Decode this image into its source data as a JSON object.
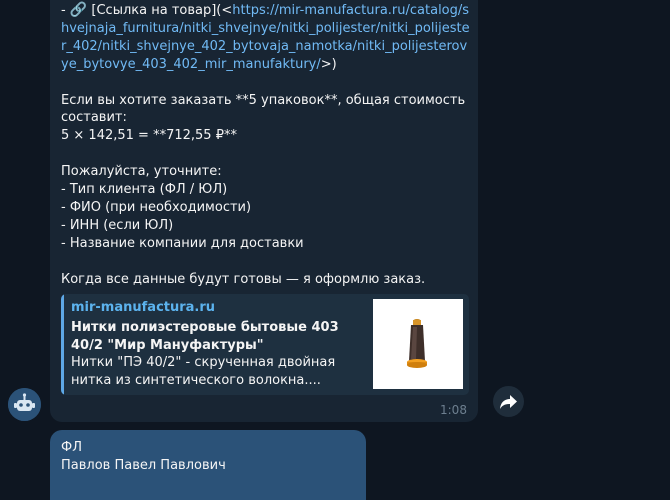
{
  "message": {
    "line1_prefix": "- ",
    "line1_icon": "link-icon",
    "line1_label": " [Ссылка на товар](<",
    "url": "https://mir-manufactura.ru/catalog/shvejnaja_furnitura/nitki_shvejnye/nitki_polijester/nitki_polijester_402/nitki_shvejnye_402_bytovaja_namotka/nitki_polijesterovye_bytovye_403_402_mir_manufaktury/",
    "line1_suffix": ">)",
    "order_line": "Если вы хотите заказать **5 упаковок**, общая стоимость составит:",
    "price_line": "5 × 142,51 = **712,55 ₽**",
    "clarify_heading": "Пожалуйста, уточните:",
    "clarify_items": [
      "- Тип клиента (ФЛ / ЮЛ)",
      "- ФИО (при необходимости)",
      "- ИНН (если ЮЛ)",
      "- Название компании для доставки"
    ],
    "closing": "Когда все данные будут готовы — я оформлю заказ.",
    "time": "1:08"
  },
  "preview": {
    "site": "mir-manufactura.ru",
    "title": "Нитки полиэстеровые бытовые 403 40/2 \"Мир Мануфактуры\"",
    "description": "Нитки \"ПЭ 40/2\" - скрученная двойная нитка из синтетического волокна...."
  },
  "reply": {
    "line1": "ФЛ",
    "line2": "Павлов Павел Павлович"
  },
  "icons": {
    "avatar": "bot-avatar-icon",
    "share": "share-icon"
  },
  "colors": {
    "background": "#0e1621",
    "incoming_bubble": "#182533",
    "outgoing_bubble": "#2b5278",
    "link": "#71baf5"
  }
}
